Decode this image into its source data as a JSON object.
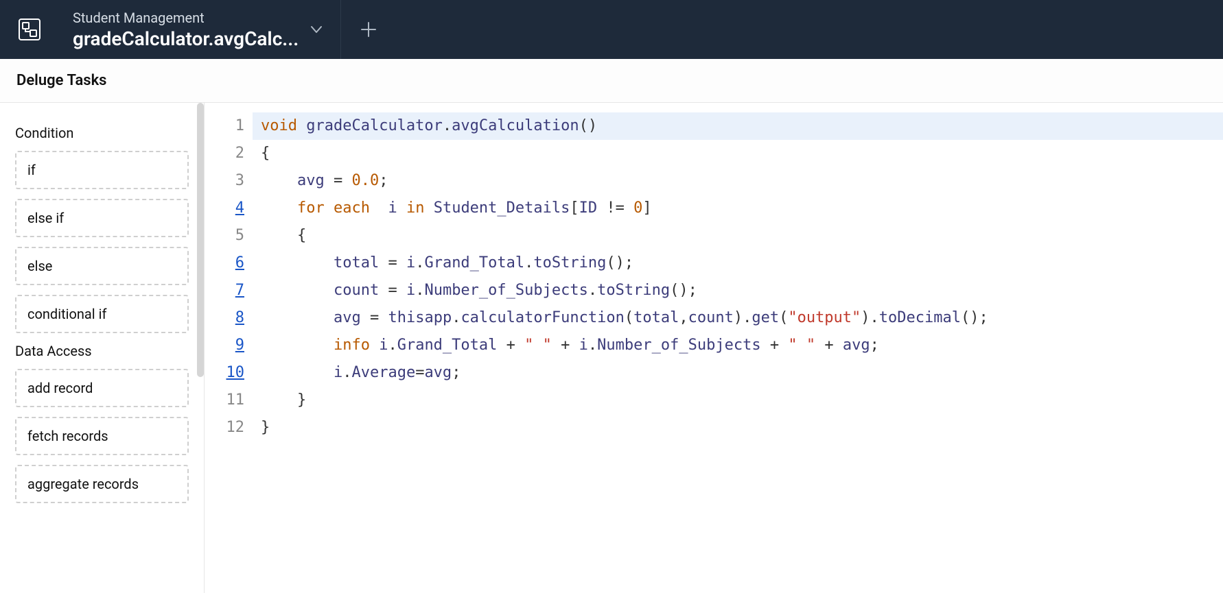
{
  "header": {
    "subtitle": "Student Management",
    "title": "gradeCalculator.avgCalc..."
  },
  "subheader": {
    "title": "Deluge Tasks"
  },
  "sidebar": {
    "sections": [
      {
        "title": "Condition",
        "items": [
          "if",
          "else if",
          "else",
          "conditional if"
        ]
      },
      {
        "title": "Data Access",
        "items": [
          "add record",
          "fetch records",
          "aggregate records"
        ]
      }
    ]
  },
  "editor": {
    "lines": [
      {
        "n": 1,
        "link": false,
        "hl": true,
        "tokens": [
          [
            "kw",
            "void"
          ],
          [
            "plain",
            " "
          ],
          [
            "name",
            "gradeCalculator"
          ],
          [
            "plain",
            "."
          ],
          [
            "name",
            "avgCalculation"
          ],
          [
            "plain",
            "()"
          ]
        ]
      },
      {
        "n": 2,
        "link": false,
        "hl": false,
        "tokens": [
          [
            "plain",
            "{"
          ]
        ]
      },
      {
        "n": 3,
        "link": false,
        "hl": false,
        "tokens": [
          [
            "plain",
            "    "
          ],
          [
            "var",
            "avg"
          ],
          [
            "plain",
            " "
          ],
          [
            "op",
            "="
          ],
          [
            "plain",
            " "
          ],
          [
            "num",
            "0.0"
          ],
          [
            "plain",
            ";"
          ]
        ]
      },
      {
        "n": 4,
        "link": true,
        "hl": false,
        "tokens": [
          [
            "plain",
            "    "
          ],
          [
            "kw",
            "for each"
          ],
          [
            "plain",
            "  "
          ],
          [
            "var",
            "i"
          ],
          [
            "plain",
            " "
          ],
          [
            "kw",
            "in"
          ],
          [
            "plain",
            " "
          ],
          [
            "name",
            "Student_Details"
          ],
          [
            "plain",
            "["
          ],
          [
            "name",
            "ID"
          ],
          [
            "plain",
            " "
          ],
          [
            "op",
            "!="
          ],
          [
            "plain",
            " "
          ],
          [
            "num",
            "0"
          ],
          [
            "plain",
            "]"
          ]
        ]
      },
      {
        "n": 5,
        "link": false,
        "hl": false,
        "tokens": [
          [
            "plain",
            "    {"
          ]
        ]
      },
      {
        "n": 6,
        "link": true,
        "hl": false,
        "tokens": [
          [
            "plain",
            "        "
          ],
          [
            "var",
            "total"
          ],
          [
            "plain",
            " "
          ],
          [
            "op",
            "="
          ],
          [
            "plain",
            " "
          ],
          [
            "var",
            "i"
          ],
          [
            "plain",
            "."
          ],
          [
            "name",
            "Grand_Total"
          ],
          [
            "plain",
            "."
          ],
          [
            "name",
            "toString"
          ],
          [
            "plain",
            "();"
          ]
        ]
      },
      {
        "n": 7,
        "link": true,
        "hl": false,
        "tokens": [
          [
            "plain",
            "        "
          ],
          [
            "var",
            "count"
          ],
          [
            "plain",
            " "
          ],
          [
            "op",
            "="
          ],
          [
            "plain",
            " "
          ],
          [
            "var",
            "i"
          ],
          [
            "plain",
            "."
          ],
          [
            "name",
            "Number_of_Subjects"
          ],
          [
            "plain",
            "."
          ],
          [
            "name",
            "toString"
          ],
          [
            "plain",
            "();"
          ]
        ]
      },
      {
        "n": 8,
        "link": true,
        "hl": false,
        "tokens": [
          [
            "plain",
            "        "
          ],
          [
            "var",
            "avg"
          ],
          [
            "plain",
            " "
          ],
          [
            "op",
            "="
          ],
          [
            "plain",
            " "
          ],
          [
            "name",
            "thisapp"
          ],
          [
            "plain",
            "."
          ],
          [
            "name",
            "calculatorFunction"
          ],
          [
            "plain",
            "("
          ],
          [
            "var",
            "total"
          ],
          [
            "plain",
            ","
          ],
          [
            "var",
            "count"
          ],
          [
            "plain",
            ")."
          ],
          [
            "name",
            "get"
          ],
          [
            "plain",
            "("
          ],
          [
            "str",
            "\"output\""
          ],
          [
            "plain",
            ")."
          ],
          [
            "name",
            "toDecimal"
          ],
          [
            "plain",
            "();"
          ]
        ]
      },
      {
        "n": 9,
        "link": true,
        "hl": false,
        "tokens": [
          [
            "plain",
            "        "
          ],
          [
            "kw",
            "info"
          ],
          [
            "plain",
            " "
          ],
          [
            "var",
            "i"
          ],
          [
            "plain",
            "."
          ],
          [
            "name",
            "Grand_Total"
          ],
          [
            "plain",
            " "
          ],
          [
            "op",
            "+"
          ],
          [
            "plain",
            " "
          ],
          [
            "str",
            "\" \""
          ],
          [
            "plain",
            " "
          ],
          [
            "op",
            "+"
          ],
          [
            "plain",
            " "
          ],
          [
            "var",
            "i"
          ],
          [
            "plain",
            "."
          ],
          [
            "name",
            "Number_of_Subjects"
          ],
          [
            "plain",
            " "
          ],
          [
            "op",
            "+"
          ],
          [
            "plain",
            " "
          ],
          [
            "str",
            "\" \""
          ],
          [
            "plain",
            " "
          ],
          [
            "op",
            "+"
          ],
          [
            "plain",
            " "
          ],
          [
            "var",
            "avg"
          ],
          [
            "plain",
            ";"
          ]
        ]
      },
      {
        "n": 10,
        "link": true,
        "hl": false,
        "tokens": [
          [
            "plain",
            "        "
          ],
          [
            "var",
            "i"
          ],
          [
            "plain",
            "."
          ],
          [
            "name",
            "Average"
          ],
          [
            "op",
            "="
          ],
          [
            "var",
            "avg"
          ],
          [
            "plain",
            ";"
          ]
        ]
      },
      {
        "n": 11,
        "link": false,
        "hl": false,
        "tokens": [
          [
            "plain",
            "    }"
          ]
        ]
      },
      {
        "n": 12,
        "link": false,
        "hl": false,
        "tokens": [
          [
            "plain",
            "}"
          ]
        ]
      }
    ]
  }
}
